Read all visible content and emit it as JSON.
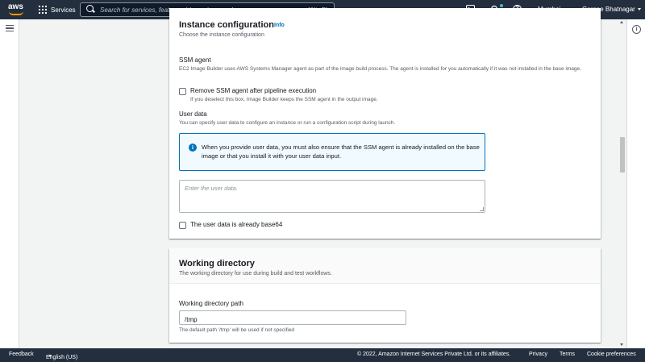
{
  "topnav": {
    "logo_text": "aws",
    "services_label": "Services",
    "search_placeholder": "Search for services, features, blogs, docs, and more",
    "search_shortcut": "[Alt+S]",
    "region_label": "Mumbai",
    "user_label": "Gargee Bhatnagar"
  },
  "instance_configuration": {
    "title": "Instance configuration",
    "info_label": "Info",
    "description": "Choose the instance configuration",
    "ssm_agent_label": "SSM agent",
    "ssm_agent_description": "EC2 Image Builder uses AWS Systems Manager agent as part of the image build process. The agent is installed for you automatically if it was not installed in the base image.",
    "remove_ssm_checkbox_label": "Remove SSM agent after pipeline execution",
    "remove_ssm_checkbox_description": "If you deselect this box, Image Builder keeps the SSM agent in the output image.",
    "user_data_label": "User data",
    "user_data_description": "You can specify user data to configure an instance or run a configuration script during launch.",
    "alert_text": "When you provide user data, you must also ensure that the SSM agent is already installed on the base image or that you install it with your user data input.",
    "user_data_placeholder": "Enter the user data.",
    "base64_checkbox_label": "The user data is already base64"
  },
  "working_directory": {
    "title": "Working directory",
    "description": "The working directory for use during build and test workflows.",
    "path_label": "Working directory path",
    "path_value": "/tmp",
    "path_hint": "The default path '/tmp' will be used if not specified"
  },
  "footer": {
    "feedback_label": "Feedback",
    "language_label": "English (US)",
    "copyright": "© 2022, Amazon Internet Services Private Ltd. or its affiliates.",
    "privacy_label": "Privacy",
    "terms_label": "Terms",
    "cookie_label": "Cookie preferences"
  },
  "colors": {
    "nav_bg": "#232f3e",
    "accent_orange": "#ff9900",
    "link_blue": "#0073bb",
    "alert_bg": "#f1faff"
  },
  "icons": [
    "aws-logo",
    "grid-icon",
    "search-icon",
    "cloudshell-icon",
    "bell-icon",
    "help-icon",
    "menu-icon",
    "info-circle-icon"
  ]
}
